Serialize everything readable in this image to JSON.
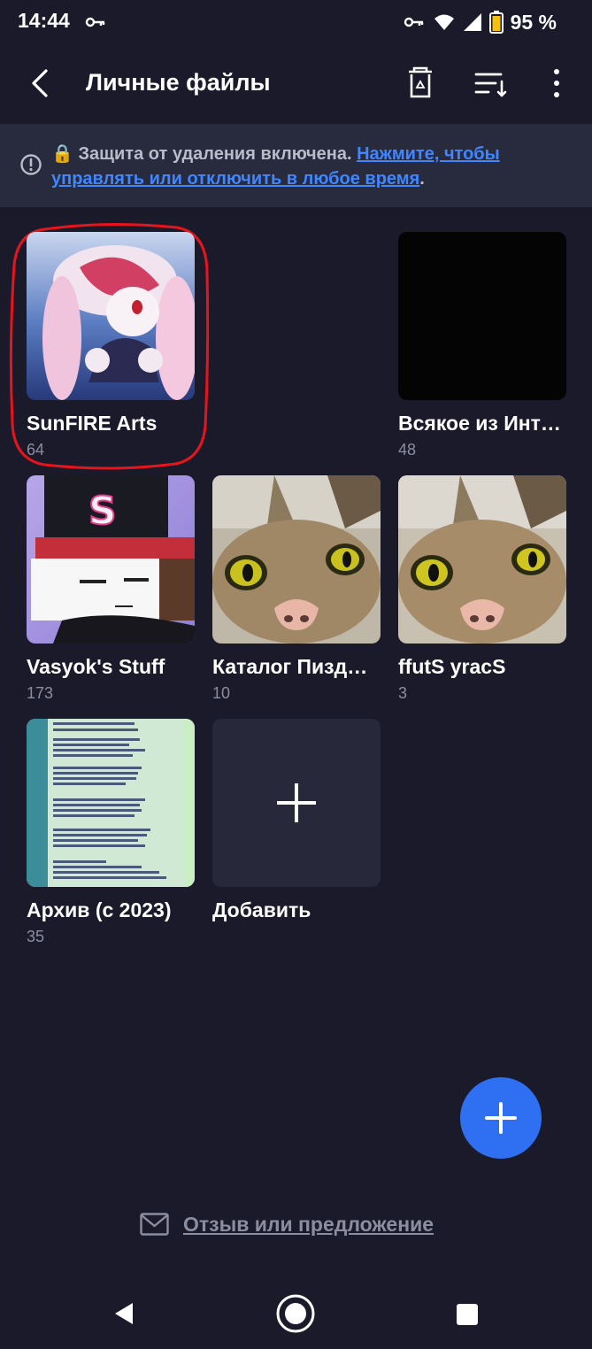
{
  "status_bar": {
    "time": "14:44",
    "battery_percent": "95 %",
    "icons": [
      "key-icon",
      "key-icon",
      "wifi-icon",
      "signal-icon",
      "battery-icon"
    ]
  },
  "header": {
    "title": "Личные файлы",
    "icons": [
      "back-arrow-icon",
      "trash-icon",
      "sort-icon",
      "more-vert-icon"
    ]
  },
  "notice": {
    "lock_emoji": "🔒",
    "text": "Защита от удаления включена. ",
    "link_text": "Нажмите, чтобы управлять или отключить в любое время",
    "trailing": ".",
    "icon": "info-icon"
  },
  "albums": [
    {
      "name": "SunFIRE Arts",
      "count": "64",
      "highlighted": true
    },
    {
      "name": "Всякое из Инт…",
      "count": "48"
    },
    {
      "name": "Vasyok's Stuff",
      "count": "173"
    },
    {
      "name": "Каталог Пизд…",
      "count": "10"
    },
    {
      "name": "ffutS yracS",
      "count": "3"
    },
    {
      "name": "Архив (с 2023)",
      "count": "35"
    }
  ],
  "add_album": {
    "label": "Добавить",
    "icon": "plus-icon"
  },
  "fab": {
    "icon": "plus-icon",
    "color": "#2f6ff2"
  },
  "feedback": {
    "label": "Отзыв или предложение",
    "icon": "mail-icon"
  },
  "nav_bar": {
    "icons": [
      "nav-back-icon",
      "nav-home-icon",
      "nav-recents-icon"
    ]
  },
  "colors": {
    "background": "#1b1a2b",
    "accent": "#3f86ff",
    "muted": "#8b8ea0",
    "highlight": "#e8141c"
  }
}
